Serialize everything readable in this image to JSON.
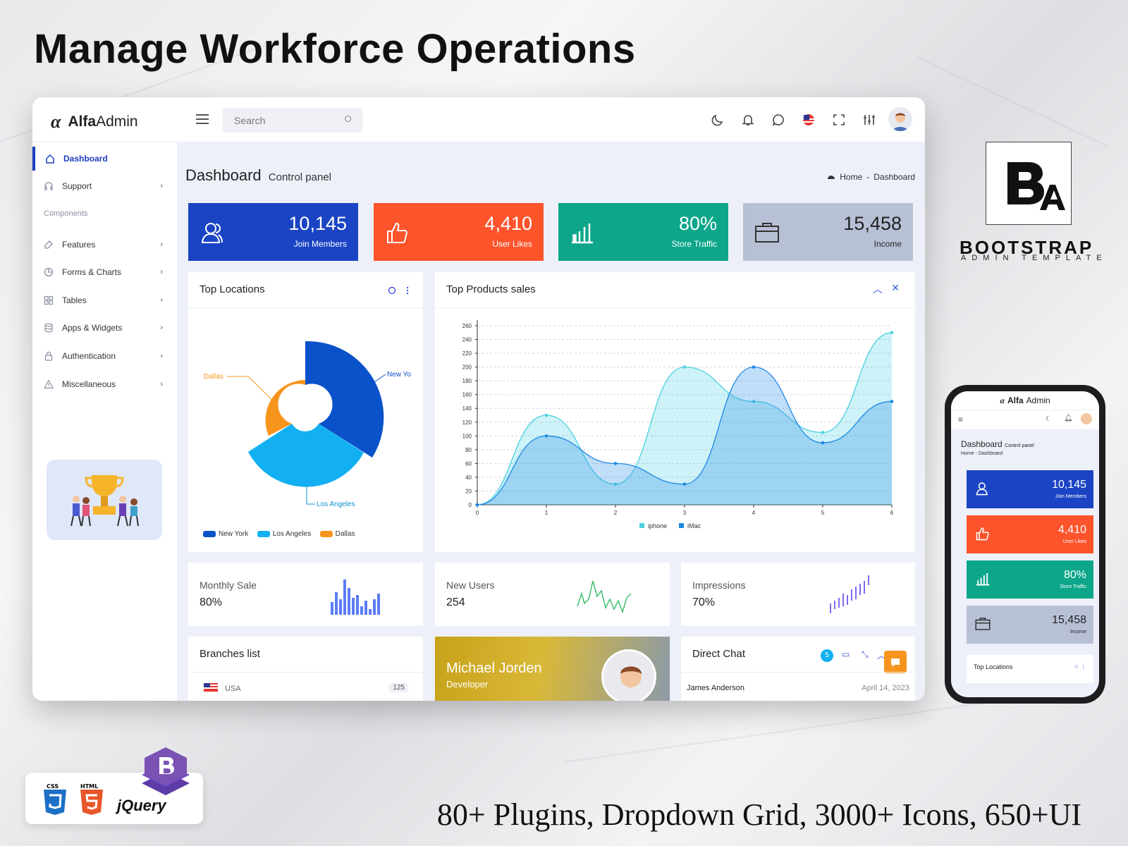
{
  "headline": "Manage Workforce Operations",
  "tagline": "80+ Plugins, Dropdown Grid, 3000+ Icons, 650+UI",
  "brand": {
    "logo_bold": "Alfa",
    "logo_light": "Admin"
  },
  "search": {
    "placeholder": "Search"
  },
  "sidebar": {
    "items": [
      {
        "label": "Dashboard",
        "icon": "home-icon",
        "active": true
      },
      {
        "label": "Support",
        "icon": "headset-icon"
      }
    ],
    "section_label": "Components",
    "components": [
      {
        "label": "Features",
        "icon": "edit-icon"
      },
      {
        "label": "Forms & Charts",
        "icon": "pie-chart-icon"
      },
      {
        "label": "Tables",
        "icon": "grid-icon"
      },
      {
        "label": "Apps & Widgets",
        "icon": "database-icon"
      },
      {
        "label": "Authentication",
        "icon": "lock-icon"
      },
      {
        "label": "Miscellaneous",
        "icon": "warning-icon"
      }
    ]
  },
  "page": {
    "title": "Dashboard",
    "subtitle": "Control panel"
  },
  "breadcrumb": {
    "home": "Home",
    "sep": "-",
    "current": "Dashboard"
  },
  "stats": [
    {
      "value": "10,145",
      "label": "Join Members",
      "color": "#1a44c4",
      "icon": "users-icon"
    },
    {
      "value": "4,410",
      "label": "User Likes",
      "color": "#fd542c",
      "icon": "thumbs-up-icon"
    },
    {
      "value": "80%",
      "label": "Store Traffic",
      "color": "#0da68a",
      "icon": "bar-chart-icon"
    },
    {
      "value": "15,458",
      "label": "Income",
      "color": "#b8c0d6",
      "icon": "briefcase-icon"
    }
  ],
  "top_locations": {
    "title": "Top Locations",
    "labels": {
      "new_york": "New Yo",
      "los_angeles": "Los Angeles",
      "dallas": "Dallas"
    },
    "legend": [
      "New York",
      "Los Angeles",
      "Dallas"
    ]
  },
  "top_products": {
    "title": "Top Products sales"
  },
  "chart_data": {
    "type": "area",
    "title": "Top Products sales",
    "x": [
      0,
      1,
      2,
      3,
      4,
      5,
      6
    ],
    "ylim": [
      0,
      260
    ],
    "yticks": [
      0,
      20,
      40,
      60,
      80,
      100,
      120,
      140,
      160,
      180,
      200,
      220,
      240,
      260
    ],
    "series": [
      {
        "name": "iphone",
        "values": [
          0,
          130,
          30,
          200,
          150,
          105,
          250
        ],
        "color": "#4dd0e1"
      },
      {
        "name": "iMac",
        "values": [
          0,
          100,
          60,
          30,
          200,
          90,
          150
        ],
        "color": "#1e88e5"
      }
    ],
    "legend": "bottom",
    "grid": true
  },
  "mini": [
    {
      "title": "Monthly Sale",
      "value": "80%"
    },
    {
      "title": "New Users",
      "value": "254"
    },
    {
      "title": "Impressions",
      "value": "70%"
    }
  ],
  "branches": {
    "title": "Branches list",
    "row_country": "USA",
    "row_count": "125"
  },
  "profile": {
    "name": "Michael Jorden",
    "role": "Developer"
  },
  "chat": {
    "title": "Direct Chat",
    "badge": "5",
    "row_name": "James Anderson",
    "row_date": "April 14, 2023"
  },
  "phone": {
    "brand_bold": "Alfa",
    "brand_light": "Admin",
    "title": "Dashboard",
    "subtitle": "Control panel",
    "crumb_home": "Home",
    "crumb_sep": "-",
    "crumb_current": "Dashboard",
    "card_title": "Top Locations"
  },
  "bootstrap_badge": {
    "title": "BOOTSTRAP",
    "subtitle": "ADMIN TEMPLATE"
  },
  "tech": [
    "CSS",
    "HTML",
    "jQuery"
  ]
}
